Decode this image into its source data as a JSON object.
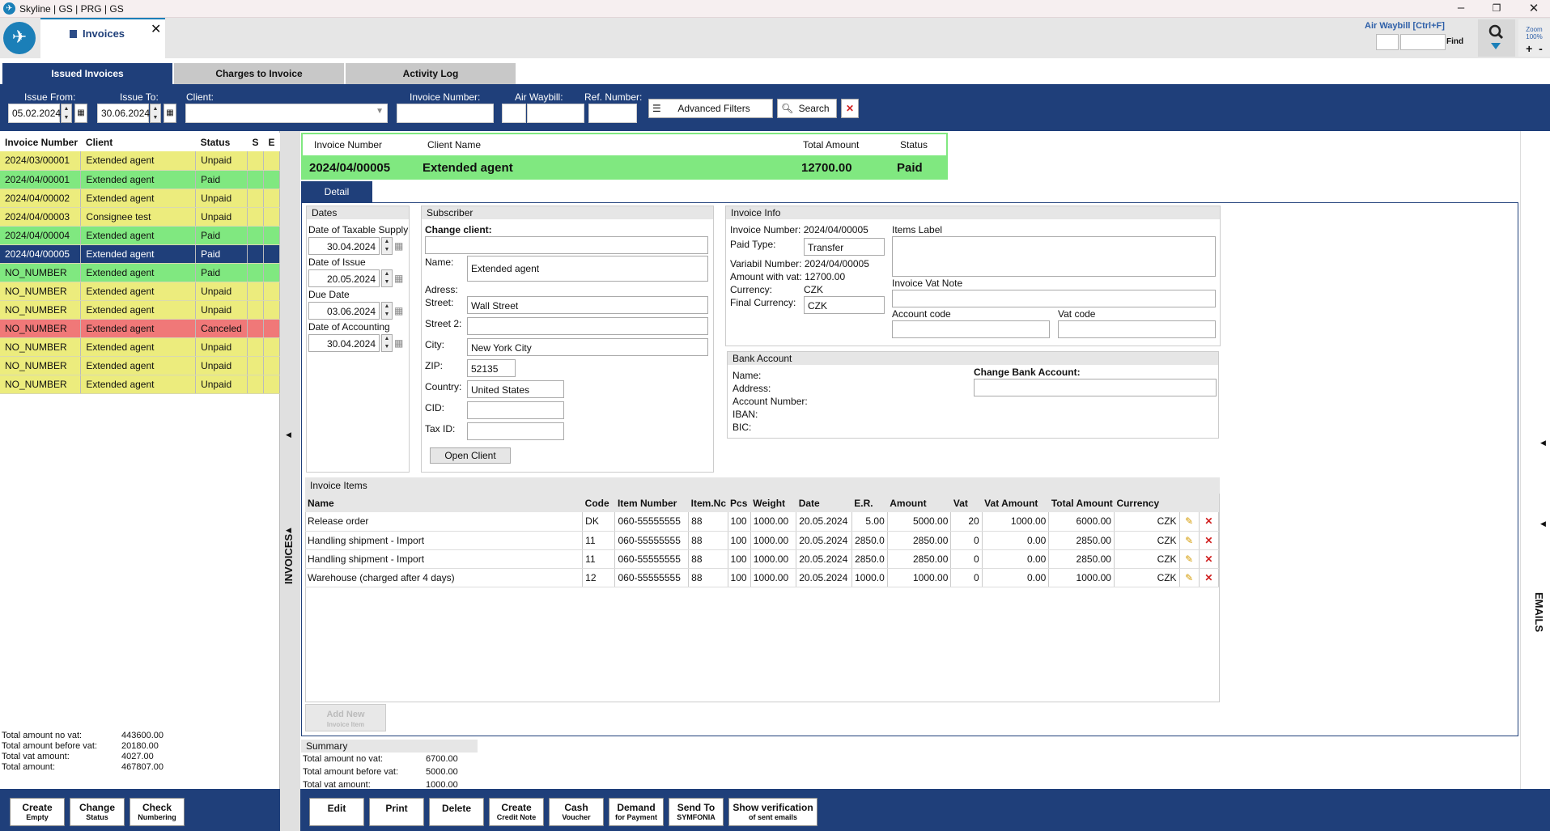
{
  "window": {
    "title": "Skyline | GS | PRG | GS"
  },
  "doc_tab": {
    "label": "Invoices"
  },
  "awb": {
    "label": "Air Waybill [Ctrl+F]",
    "find": "Find",
    "zoom_label": "Zoom",
    "zoom_value": "100%"
  },
  "tabs": [
    "Issued Invoices",
    "Charges to Invoice",
    "Activity Log"
  ],
  "filters": {
    "issue_from_label": "Issue From:",
    "issue_from": "05.02.2024",
    "issue_to_label": "Issue To:",
    "issue_to": "30.06.2024",
    "client_label": "Client:",
    "invoice_number_label": "Invoice Number:",
    "air_waybill_label": "Air Waybill:",
    "ref_number_label": "Ref. Number:",
    "advanced_filters": "Advanced Filters",
    "search": "Search"
  },
  "list": {
    "headers": [
      "Invoice Number",
      "Client",
      "Status",
      "S",
      "E"
    ],
    "rows": [
      {
        "number": "2024/03/00001",
        "client": "Extended agent",
        "status": "Unpaid",
        "color": "yellow"
      },
      {
        "number": "2024/04/00001",
        "client": "Extended agent",
        "status": "Paid",
        "color": "green"
      },
      {
        "number": "2024/04/00002",
        "client": "Extended agent",
        "status": "Unpaid",
        "color": "yellow"
      },
      {
        "number": "2024/04/00003",
        "client": "Consignee test",
        "status": "Unpaid",
        "color": "yellow"
      },
      {
        "number": "2024/04/00004",
        "client": "Extended agent",
        "status": "Paid",
        "color": "green"
      },
      {
        "number": "2024/04/00005",
        "client": "Extended agent",
        "status": "Paid",
        "color": "sel"
      },
      {
        "number": "NO_NUMBER",
        "client": "Extended agent",
        "status": "Paid",
        "color": "green"
      },
      {
        "number": "NO_NUMBER",
        "client": "Extended agent",
        "status": "Unpaid",
        "color": "yellow"
      },
      {
        "number": "NO_NUMBER",
        "client": "Extended agent",
        "status": "Unpaid",
        "color": "yellow"
      },
      {
        "number": "NO_NUMBER",
        "client": "Extended agent",
        "status": "Canceled",
        "color": "red"
      },
      {
        "number": "NO_NUMBER",
        "client": "Extended agent",
        "status": "Unpaid",
        "color": "yellow"
      },
      {
        "number": "NO_NUMBER",
        "client": "Extended agent",
        "status": "Unpaid",
        "color": "yellow"
      },
      {
        "number": "NO_NUMBER",
        "client": "Extended agent",
        "status": "Unpaid",
        "color": "yellow"
      }
    ]
  },
  "left_totals": [
    {
      "label": "Total amount no vat:",
      "value": "443600.00"
    },
    {
      "label": "Total amount before vat:",
      "value": "20180.00"
    },
    {
      "label": "Total vat amount:",
      "value": "4027.00"
    },
    {
      "label": "Total amount:",
      "value": "467807.00"
    }
  ],
  "left_buttons": [
    {
      "main": "Create",
      "sub": "Empty"
    },
    {
      "main": "Change",
      "sub": "Status"
    },
    {
      "main": "Check",
      "sub": "Numbering"
    }
  ],
  "side_labels": {
    "left": "INVOICES",
    "right": "EMAILS"
  },
  "header": {
    "h_number": "Invoice Number",
    "h_client": "Client Name",
    "h_total": "Total Amount",
    "h_status": "Status",
    "number": "2024/04/00005",
    "client": "Extended agent",
    "total": "12700.00",
    "status": "Paid"
  },
  "detail_tab": "Detail",
  "dates": {
    "title": "Dates",
    "taxable_label": "Date of Taxable Supply",
    "taxable": "30.04.2024",
    "issue_label": "Date of Issue",
    "issue": "20.05.2024",
    "due_label": "Due Date",
    "due": "03.06.2024",
    "accounting_label": "Date of Accounting",
    "accounting": "30.04.2024"
  },
  "subscriber": {
    "title": "Subscriber",
    "change_client": "Change client:",
    "name_label": "Name:",
    "name": "Extended agent",
    "adress_label": "Adress:",
    "street_label": "Street:",
    "street": "Wall Street",
    "street2_label": "Street 2:",
    "city_label": "City:",
    "city": "New York City",
    "zip_label": "ZIP:",
    "zip": "52135",
    "country_label": "Country:",
    "country": "United States",
    "cid_label": "CID:",
    "taxid_label": "Tax ID:",
    "open_client": "Open Client"
  },
  "invoice_info": {
    "title": "Invoice Info",
    "number_label": "Invoice Number:",
    "number": "2024/04/00005",
    "paid_type_label": "Paid Type:",
    "paid_type": "Transfer",
    "variabil_label": "Variabil Number:",
    "variabil": "2024/04/00005",
    "amount_label": "Amount with vat:",
    "amount": "12700.00",
    "currency_label": "Currency:",
    "currency": "CZK",
    "final_currency_label": "Final Currency:",
    "final_currency": "CZK",
    "items_label": "Items Label",
    "vat_note_label": "Invoice Vat Note",
    "account_code_label": "Account code",
    "vat_code_label": "Vat code"
  },
  "bank": {
    "title": "Bank Account",
    "name": "Name:",
    "address": "Address:",
    "account_number": "Account Number:",
    "iban": "IBAN:",
    "bic": "BIC:",
    "change": "Change Bank Account:"
  },
  "items": {
    "title": "Invoice Items",
    "headers": [
      "Name",
      "Code",
      "Item Number",
      "Item.Nc",
      "Pcs",
      "Weight",
      "Date",
      "E.R.",
      "Amount",
      "Vat",
      "Vat Amount",
      "Total Amount",
      "Currency"
    ],
    "rows": [
      [
        "Release order",
        "DK",
        "060-55555555",
        "88",
        "100",
        "1000.00",
        "20.05.2024",
        "5.00",
        "5000.00",
        "20",
        "1000.00",
        "6000.00",
        "CZK"
      ],
      [
        "Handling shipment - Import",
        "11",
        "060-55555555",
        "88",
        "100",
        "1000.00",
        "20.05.2024",
        "2850.0",
        "2850.00",
        "0",
        "0.00",
        "2850.00",
        "CZK"
      ],
      [
        "Handling shipment - Import",
        "11",
        "060-55555555",
        "88",
        "100",
        "1000.00",
        "20.05.2024",
        "2850.0",
        "2850.00",
        "0",
        "0.00",
        "2850.00",
        "CZK"
      ],
      [
        "Warehouse (charged after 4 days)",
        "12",
        "060-55555555",
        "88",
        "100",
        "1000.00",
        "20.05.2024",
        "1000.0",
        "1000.00",
        "0",
        "0.00",
        "1000.00",
        "CZK"
      ]
    ],
    "add_new": "Add New",
    "add_new_sub": "Invoice Item"
  },
  "summary": {
    "title": "Summary",
    "rows": [
      {
        "label": "Total amount no vat:",
        "value": "6700.00"
      },
      {
        "label": "Total amount before vat:",
        "value": "5000.00"
      },
      {
        "label": "Total vat amount:",
        "value": "1000.00"
      }
    ]
  },
  "bottom_buttons": [
    {
      "main": "Edit",
      "sub": ""
    },
    {
      "main": "Print",
      "sub": ""
    },
    {
      "main": "Delete",
      "sub": ""
    },
    {
      "main": "Create",
      "sub": "Credit Note"
    },
    {
      "main": "Cash",
      "sub": "Voucher"
    },
    {
      "main": "Demand",
      "sub": "for Payment"
    },
    {
      "main": "Send To",
      "sub": "SYMFONIA"
    },
    {
      "main": "Show verification",
      "sub": "of sent emails"
    }
  ],
  "colors": {
    "navy": "#1f3f7a",
    "green": "#80e880",
    "yellow": "#ecec7d",
    "red": "#f07878"
  }
}
